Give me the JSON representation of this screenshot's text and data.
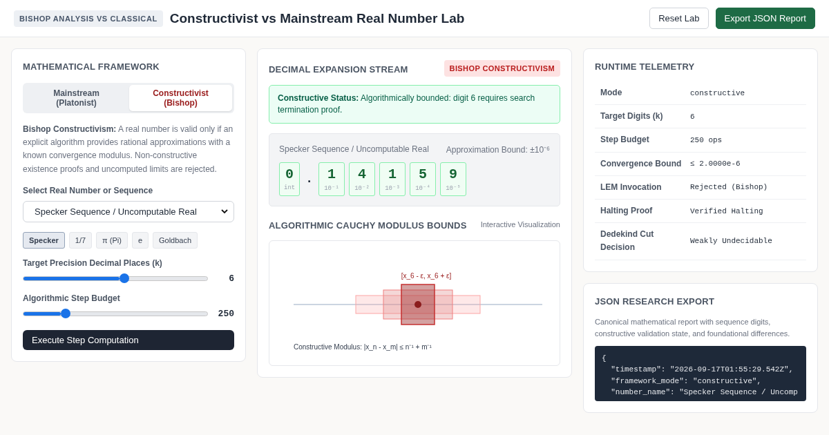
{
  "header": {
    "badge": "BISHOP ANALYSIS VS CLASSICAL",
    "title": "Constructivist vs Mainstream Real Number Lab",
    "buttons": [
      {
        "label": "Reset Lab",
        "kind": "secondary"
      },
      {
        "label": "Export JSON Report",
        "kind": "primary"
      }
    ]
  },
  "framework": {
    "title": "MATHEMATICAL FRAMEWORK",
    "tabs": [
      {
        "label": "Mainstream (Platonist)",
        "selected": false
      },
      {
        "label": "Constructivist (Bishop)",
        "selected": true
      }
    ],
    "description": "**Bishop Constructivism:** A real number is valid only if an explicit algorithm provides rational approximations with a known convergence modulus. Non-constructive existence proofs and uncomputed limits are rejected.",
    "select_label": "Select Real Number or Sequence",
    "select_value": "Specker Sequence / Uncomputable Real",
    "presets": [
      {
        "label": "Specker",
        "selected": true
      },
      {
        "label": "1/7",
        "selected": false
      },
      {
        "label": "π (Pi)",
        "selected": false
      },
      {
        "label": "e",
        "selected": false
      },
      {
        "label": "Goldbach",
        "selected": false
      }
    ],
    "sliders": [
      {
        "label": "Target Precision Decimal Places (k)",
        "level": 0.55,
        "reading": "6"
      },
      {
        "label": "Algorithmic Step Budget",
        "level": 0.23,
        "reading": "250"
      }
    ],
    "action": "Execute Step Computation"
  },
  "stream": {
    "title": "DECIMAL EXPANSION STREAM",
    "badge": "BISHOP CONSTRUCTIVISM",
    "status": "**Constructive Status:** Algorithmically bounded: digit 6 requires search termination proof.",
    "sequence_name": "Specker Sequence / Uncomputable Real",
    "bound": "Approximation Bound: ±10⁻⁶",
    "integer": {
      "digit": "0",
      "place": "int"
    },
    "point": ".",
    "digits": [
      {
        "digit": "1",
        "place": "10⁻¹"
      },
      {
        "digit": "4",
        "place": "10⁻²"
      },
      {
        "digit": "1",
        "place": "10⁻³"
      },
      {
        "digit": "5",
        "place": "10⁻⁴"
      },
      {
        "digit": "9",
        "place": "10⁻⁵"
      }
    ]
  },
  "modulus": {
    "title": "ALGORITHMIC CAUCHY MODULUS BOUNDS",
    "subtitle": "Interactive Visualization",
    "interval_label": "[x_6 - ε, x_6 + ε]",
    "caption": "Constructive Modulus: |x_n - x_m| ≤ n⁻¹ + m⁻¹"
  },
  "telemetry": {
    "title": "RUNTIME TELEMETRY",
    "rows": [
      {
        "label": "Mode",
        "value": "constructive"
      },
      {
        "label": "Target Digits (k)",
        "value": "6"
      },
      {
        "label": "Step Budget",
        "value": "250 ops"
      },
      {
        "label": "Convergence Bound",
        "value": "≤ 2.0000e-6"
      },
      {
        "label": "LEM Invocation",
        "value": "Rejected (Bishop)"
      },
      {
        "label": "Halting Proof",
        "value": "Verified Halting"
      },
      {
        "label": "Dedekind Cut Decision",
        "value": "Weakly Undecidable"
      }
    ]
  },
  "export": {
    "title": "JSON RESEARCH EXPORT",
    "description": "Canonical mathematical report with sequence digits, constructive validation state, and foundational differences.",
    "code_lines": [
      "{",
      "  \"timestamp\": \"2026-09-17T01:55:29.542Z\",",
      "  \"framework_mode\": \"constructive\",",
      "  \"number_name\": \"Specker Sequence / Uncomp"
    ]
  }
}
